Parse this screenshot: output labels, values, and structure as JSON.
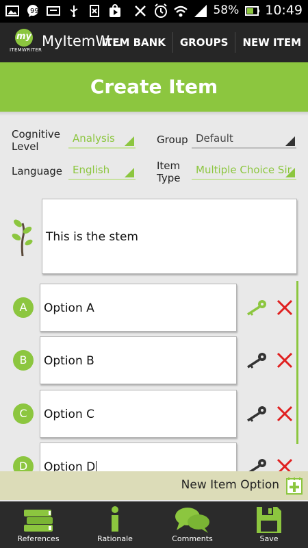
{
  "status_bar": {
    "battery": "58%",
    "time": "10:49"
  },
  "action_bar": {
    "logo_text": "my",
    "logo_subtext": "ITEMWRITER",
    "app_title": "MyItemW...",
    "tabs": [
      "ITEM BANK",
      "GROUPS",
      "NEW ITEM"
    ]
  },
  "header": {
    "title": "Create Item"
  },
  "form": {
    "cognitive_level_label": "Cognitive Level",
    "cognitive_level_value": "Analysis",
    "group_label": "Group",
    "group_value": "Default",
    "language_label": "Language",
    "language_value": "English",
    "item_type_label": "Item Type",
    "item_type_value": "Multiple Choice Sir"
  },
  "stem": {
    "text": "This is the stem"
  },
  "options": [
    {
      "letter": "A",
      "text": "Option A",
      "is_key": true
    },
    {
      "letter": "B",
      "text": "Option B",
      "is_key": false
    },
    {
      "letter": "C",
      "text": "Option C",
      "is_key": false
    },
    {
      "letter": "D",
      "text": "Option D",
      "is_key": false
    }
  ],
  "new_option": {
    "label": "New Item Option"
  },
  "bottom_bar": {
    "items": [
      "References",
      "Rationale",
      "Comments",
      "Save"
    ]
  },
  "colors": {
    "accent_green": "#8cc63f",
    "action_bar": "#262626",
    "delete_red": "#e02020",
    "key_dark": "#333333"
  }
}
